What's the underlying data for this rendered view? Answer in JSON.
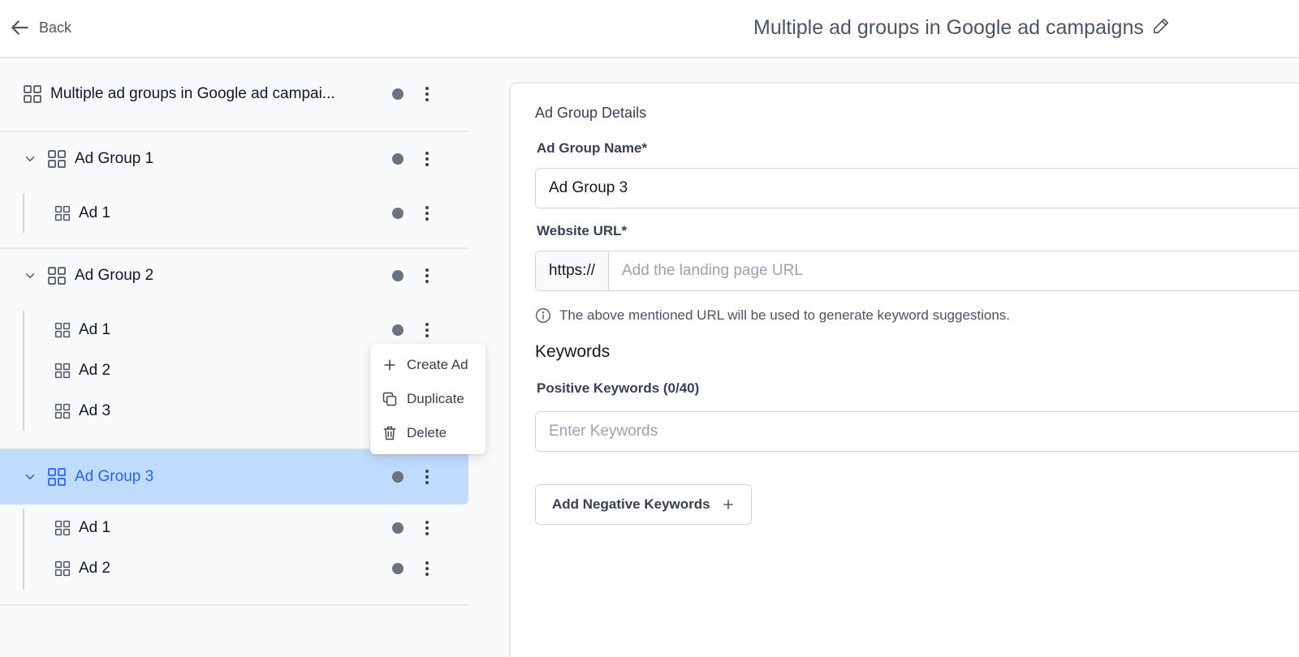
{
  "header": {
    "back_label": "Back",
    "title": "Multiple ad groups in Google ad campaigns"
  },
  "sidebar": {
    "campaign_label": "Multiple ad groups in Google ad campai...",
    "groups": [
      {
        "label": "Ad Group 1",
        "ads": [
          "Ad 1"
        ]
      },
      {
        "label": "Ad Group 2",
        "ads": [
          "Ad 1",
          "Ad 2",
          "Ad 3"
        ]
      },
      {
        "label": "Ad Group 3",
        "ads": [
          "Ad 1",
          "Ad 2"
        ],
        "selected": true
      }
    ]
  },
  "context_menu": {
    "items": [
      {
        "label": "Create Ad",
        "icon": "plus-icon"
      },
      {
        "label": "Duplicate",
        "icon": "copy-icon"
      },
      {
        "label": "Delete",
        "icon": "trash-icon"
      }
    ]
  },
  "details": {
    "section_title": "Ad Group Details",
    "name_label": "Ad Group Name*",
    "name_value": "Ad Group 3",
    "url_label": "Website URL*",
    "url_prefix": "https://",
    "url_placeholder": "Add the landing page URL",
    "url_hint": "The above mentioned URL will be used to generate keyword suggestions.",
    "keywords_heading": "Keywords",
    "positive_label": "Positive Keywords (0/40)",
    "positive_placeholder": "Enter Keywords",
    "negative_button": "Add Negative Keywords"
  },
  "colors": {
    "accent": "#2563eb",
    "selected_bg": "#bfdbfe",
    "status_dot": "#6b7280"
  }
}
